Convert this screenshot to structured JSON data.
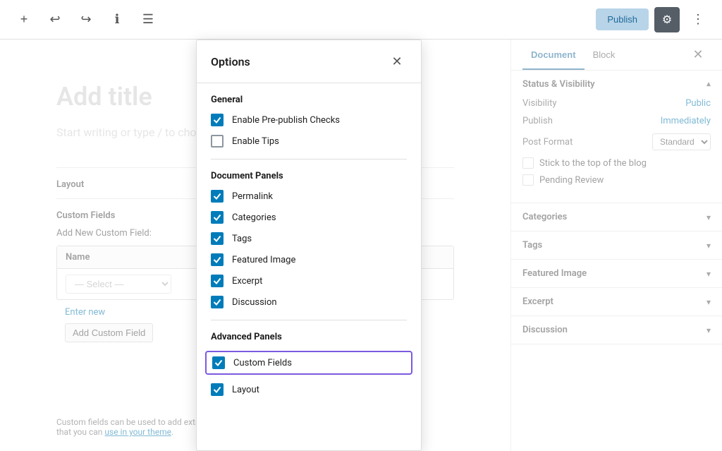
{
  "toolbar": {
    "publish_label": "Publish",
    "settings_icon": "⚙",
    "more_icon": "⋮",
    "add_icon": "+",
    "undo_icon": "↩",
    "redo_icon": "↪",
    "info_icon": "ℹ",
    "list_icon": "☰"
  },
  "editor": {
    "title_placeholder": "Add title",
    "content_placeholder": "Start writing or type / to choose a block"
  },
  "meta": {
    "layout_label": "Layout",
    "custom_fields_label": "Custom Fields",
    "add_new_label": "Add New Custom Field:",
    "name_column": "Name",
    "select_placeholder": "— Select —",
    "enter_new": "Enter new",
    "add_button": "Add Custom Field",
    "footer_text": "Custom fields can be used to add extra metadata to a post that you can ",
    "footer_link": "use in your theme",
    "footer_period": "."
  },
  "sidebar": {
    "document_tab": "Document",
    "block_tab": "Block",
    "close_icon": "✕",
    "panels": {
      "status_visibility": {
        "title": "Status & Visibility",
        "expanded": true,
        "visibility_label": "Visibility",
        "visibility_value": "Public",
        "publish_label": "Publish",
        "publish_value": "Immediately",
        "post_format_label": "Post Format",
        "post_format_value": "Standard",
        "stick_label": "Stick to the top of the blog",
        "pending_label": "Pending Review"
      },
      "categories": {
        "title": "Categories"
      },
      "tags": {
        "title": "Tags"
      },
      "featured_image": {
        "title": "Featured Image"
      },
      "excerpt": {
        "title": "Excerpt"
      },
      "discussion": {
        "title": "Discussion"
      }
    }
  },
  "modal": {
    "title": "Options",
    "close_icon": "✕",
    "general_section": "General",
    "document_panels_section": "Document Panels",
    "advanced_panels_section": "Advanced Panels",
    "options": {
      "general": [
        {
          "label": "Enable Pre-publish Checks",
          "checked": true
        },
        {
          "label": "Enable Tips",
          "checked": false
        }
      ],
      "document_panels": [
        {
          "label": "Permalink",
          "checked": true
        },
        {
          "label": "Categories",
          "checked": true
        },
        {
          "label": "Tags",
          "checked": true
        },
        {
          "label": "Featured Image",
          "checked": true
        },
        {
          "label": "Excerpt",
          "checked": true
        },
        {
          "label": "Discussion",
          "checked": true
        }
      ],
      "advanced_panels": [
        {
          "label": "Custom Fields",
          "checked": true,
          "highlighted": true
        },
        {
          "label": "Layout",
          "checked": true
        }
      ]
    }
  }
}
